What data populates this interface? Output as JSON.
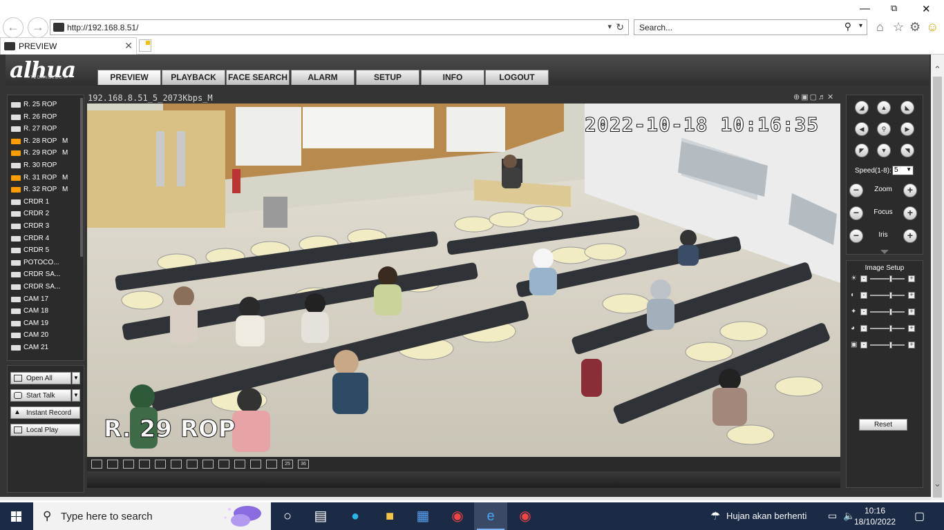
{
  "browser": {
    "url": "http://192.168.8.51/",
    "search_placeholder": "Search...",
    "tab_title": "PREVIEW"
  },
  "app": {
    "logo": "alhua",
    "logo_sub": "TECHNOLOGY",
    "nav": [
      "PREVIEW",
      "PLAYBACK",
      "FACE SEARCH",
      "ALARM",
      "SETUP",
      "INFO",
      "LOGOUT"
    ],
    "active_nav": "PREVIEW"
  },
  "devices": [
    {
      "name": "R. 25 ROP",
      "flag": "",
      "active": false
    },
    {
      "name": "R. 26 ROP",
      "flag": "",
      "active": false
    },
    {
      "name": "R. 27 ROP",
      "flag": "",
      "active": false
    },
    {
      "name": "R. 28 ROP",
      "flag": "M",
      "active": true
    },
    {
      "name": "R. 29 ROP",
      "flag": "M",
      "active": true
    },
    {
      "name": "R. 30 ROP",
      "flag": "",
      "active": false
    },
    {
      "name": "R. 31 ROP",
      "flag": "M",
      "active": true
    },
    {
      "name": "R. 32 ROP",
      "flag": "M",
      "active": true
    },
    {
      "name": "CRDR 1",
      "flag": "",
      "active": false
    },
    {
      "name": "CRDR 2",
      "flag": "",
      "active": false
    },
    {
      "name": "CRDR 3",
      "flag": "",
      "active": false
    },
    {
      "name": "CRDR 4",
      "flag": "",
      "active": false
    },
    {
      "name": "CRDR 5",
      "flag": "",
      "active": false
    },
    {
      "name": "POTOCO...",
      "flag": "",
      "active": false
    },
    {
      "name": "CRDR SA...",
      "flag": "",
      "active": false
    },
    {
      "name": "CRDR SA...",
      "flag": "",
      "active": false
    },
    {
      "name": "CAM 17",
      "flag": "",
      "active": false
    },
    {
      "name": "CAM 18",
      "flag": "",
      "active": false
    },
    {
      "name": "CAM 19",
      "flag": "",
      "active": false
    },
    {
      "name": "CAM 20",
      "flag": "",
      "active": false
    },
    {
      "name": "CAM 21",
      "flag": "",
      "active": false
    }
  ],
  "controls": {
    "open_all": "Open All",
    "start_talk": "Start Talk",
    "instant_record": "Instant Record",
    "local_play": "Local Play"
  },
  "video": {
    "title": "192.168.8.51_5_2073Kbps_M",
    "osd_datetime": "2022-10-18 10:16:35",
    "osd_channel": "R. 29 ROP"
  },
  "split_modes": [
    "",
    "",
    "",
    "",
    "",
    "",
    "",
    "",
    "",
    "",
    "",
    "",
    "25",
    "36"
  ],
  "ptz": {
    "speed_label": "Speed(1-8):",
    "speed_value": "5",
    "zoom": "Zoom",
    "focus": "Focus",
    "iris": "Iris"
  },
  "image_setup": {
    "title": "Image Setup",
    "reset": "Reset",
    "levels": [
      0.6,
      0.6,
      0.6,
      0.6,
      0.6
    ]
  },
  "taskbar": {
    "search_placeholder": "Type here to search",
    "weather": "Hujan akan berhenti",
    "time": "10:16",
    "date": "18/10/2022"
  }
}
